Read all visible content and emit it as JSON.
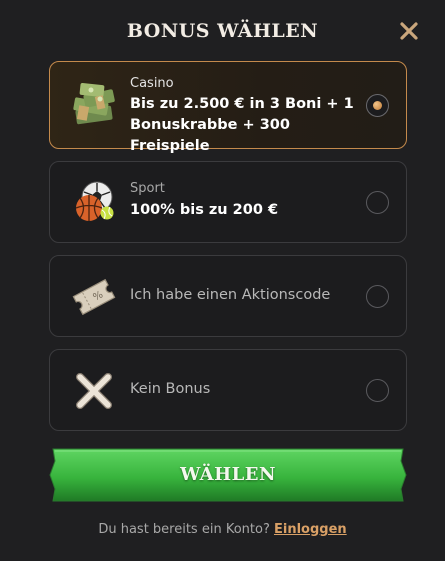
{
  "dialog": {
    "title": "BONUS WÄHLEN",
    "close_icon": "close-x-icon"
  },
  "options": [
    {
      "id": "casino",
      "category": "Casino",
      "text": "Bis zu 2.500 € in 3 Boni + 1 Bonuskrabbe + 300 Freispiele",
      "icon": "money-stack-icon",
      "selected": true
    },
    {
      "id": "sport",
      "category": "Sport",
      "text": "100% bis zu 200 €",
      "icon": "sports-balls-icon",
      "selected": false
    },
    {
      "id": "code",
      "text": "Ich habe einen Aktionscode",
      "icon": "ticket-icon",
      "selected": false
    },
    {
      "id": "none",
      "text": "Kein Bonus",
      "icon": "cross-icon",
      "selected": false
    }
  ],
  "action": {
    "choose_label": "WÄHLEN"
  },
  "footer": {
    "prompt": "Du hast bereits ein Konto?",
    "login_label": "Einloggen"
  },
  "colors": {
    "accent": "#d9a066",
    "button_green": "#3db845",
    "background": "#1f1f21"
  }
}
